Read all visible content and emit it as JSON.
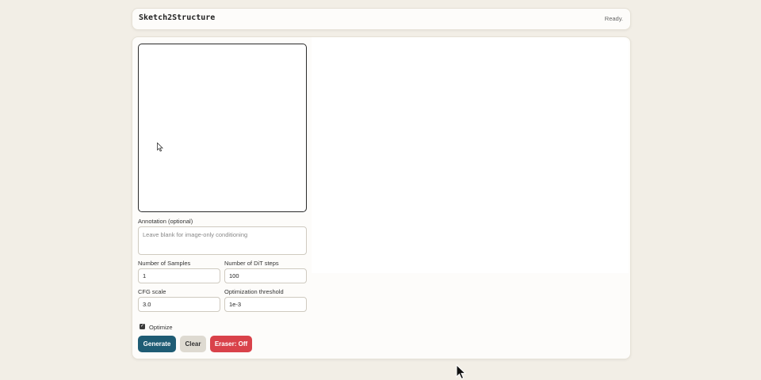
{
  "header": {
    "app_title": "Sketch2Structure",
    "status": "Ready."
  },
  "form": {
    "annotation_label": "Annotation (optional)",
    "annotation_placeholder": "Leave blank for image-only conditioning",
    "annotation_value": "",
    "num_samples_label": "Number of Samples",
    "num_samples_value": "1",
    "dit_steps_label": "Number of DiT steps",
    "dit_steps_value": "100",
    "cfg_label": "CFG scale",
    "cfg_value": "3.0",
    "opt_threshold_label": "Optimization threshold",
    "opt_threshold_value": "1e-3",
    "optimize_label": "Optimize",
    "optimize_checked": true
  },
  "buttons": {
    "generate": "Generate",
    "clear": "Clear",
    "eraser": "Eraser: Off"
  },
  "icons": {
    "pointer": "mouse-pointer-icon",
    "check": "checkmark-icon"
  },
  "colors": {
    "generate": "#1f5c74",
    "clear": "#dedad1",
    "eraser": "#d9424a",
    "background": "#f2eee6"
  }
}
